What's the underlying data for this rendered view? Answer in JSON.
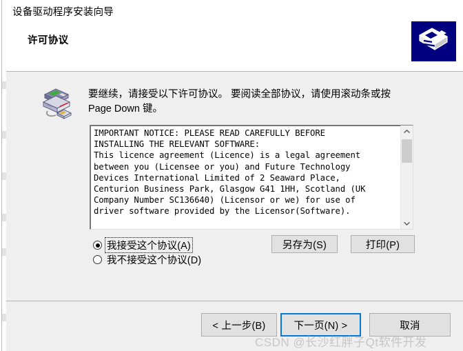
{
  "window": {
    "title": "设备驱动程序安装向导",
    "page_heading": "许可协议",
    "header_icon": "driver-wizard-icon",
    "colors": {
      "header_icon_bg": "#000080",
      "body_bg": "#efefef",
      "header_bg": "#ffffff",
      "default_button_focus": "#0078d7",
      "divider": "#b4b4b4"
    }
  },
  "body": {
    "side_icon": "driver-stack-icon",
    "instruction": "要继续，请接受以下许可协议。 要阅读全部协议，请使用滚动条或按 Page Down 键。",
    "license": {
      "text": "IMPORTANT NOTICE: PLEASE READ CAREFULLY BEFORE\nINSTALLING THE RELEVANT SOFTWARE:\nThis licence agreement (Licence) is a legal agreement\nbetween you (Licensee or you) and Future Technology\nDevices International Limited of 2 Seaward Place,\nCenturion Business Park, Glasgow G41 1HH, Scotland (UK\nCompany Number SC136640) (Licensor or we) for use of\ndriver software provided by the Licensor(Software).",
      "scrollbar": {
        "up_arrow_icon": "chevron-up-icon",
        "down_arrow_icon": "chevron-down-icon",
        "thumb_position_percent": 13
      }
    },
    "radio_options": [
      {
        "label": "我接受这个协议(A)",
        "checked": true,
        "focused": true
      },
      {
        "label": "我不接受这个协议(D)",
        "checked": false,
        "focused": false
      }
    ],
    "buttons": {
      "save_as": "另存为(S)",
      "print": "打印(P)"
    }
  },
  "footer": {
    "back": "< 上一步(B)",
    "next": "下一页(N) >",
    "cancel": "取消"
  },
  "watermark": {
    "text": "CSDN @长沙红胖子Qt软件开发"
  }
}
